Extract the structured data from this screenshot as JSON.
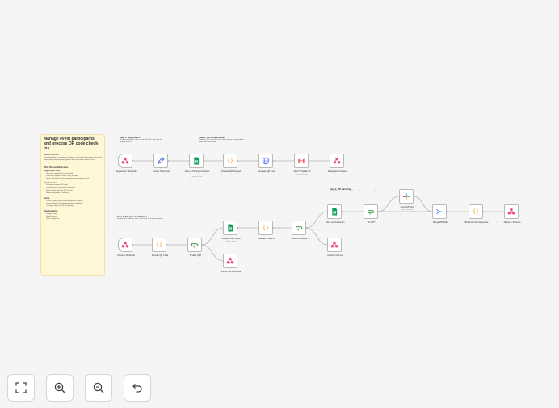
{
  "sticky": {
    "title": "Manage event participants and process QR code check-ins",
    "who_heading": "Who is this for?",
    "who_text": "Event organizers, conference managers, and community teams who need automated participant management with registration and check-in tracking.",
    "what_heading": "What this workflow does",
    "registration_heading": "Registration Flow",
    "registration_items": [
      "Receives registration via webhook",
      "Generates unique ticket ID and QR code",
      "Stores to Google Sheets and sends confirmation email"
    ],
    "checkin_heading": "Check-in Flow",
    "checkin_items": [
      "Decodes scanned QR code",
      "Validates ticket and blocks duplicates",
      "Sends Slack alerts for VIP arrivals",
      "Returns attendance statistics"
    ],
    "setup_heading": "Setup",
    "setup_items": [
      "Create Google Sheet with participants columns",
      "Connect Google Sheets and Gmail credentials",
      "Configure Slack for VIP notifications"
    ],
    "requirements_heading": "Requirements",
    "requirements_items": [
      "Google Sheets",
      "Gmail account",
      "Slack workspace"
    ]
  },
  "steps": {
    "registration": {
      "title": "Step 1: Registration",
      "desc": "Receive participant data, create ticket ID, and save to Google Sheets"
    },
    "qr_email": {
      "title": "Step 2: QR Code & Email",
      "desc": "Generate QR code with ticket data and send confirmation email with attachment"
    },
    "checkin": {
      "title": "Step 3: Check-in & Validation",
      "desc": "Decode QR, validate ticket, and check for duplicate entries"
    },
    "vip": {
      "title": "Step 4: VIP Handling",
      "desc": "Detect VIP tickets and send Slack notification to event staff"
    }
  },
  "nodes": {
    "registration_webhook": {
      "label": "Registration Webhook"
    },
    "create_ticket_data": {
      "label": "Create Ticket Data"
    },
    "save_to_sheet": {
      "label": "Save to Participants Sheet",
      "sub": "append: sheet"
    },
    "prepare_qr_payload": {
      "label": "Prepare QR Payload"
    },
    "generate_qr_code": {
      "label": "Generate QR Code"
    },
    "send_ticket_email": {
      "label": "Send Ticket Email",
      "sub": "send: message"
    },
    "registration_success": {
      "label": "Registration Success"
    },
    "checkin_webhook": {
      "label": "Check-in Webhook"
    },
    "decode_qr_code": {
      "label": "Decode QR Code"
    },
    "is_valid_qr": {
      "label": "Is Valid QR?"
    },
    "lookup_ticket": {
      "label": "Lookup Ticket in DB",
      "sub": "lookup: sheet"
    },
    "invalid_qr_response": {
      "label": "Invalid QR Response"
    },
    "validate_checkin": {
      "label": "Validate Check-in"
    },
    "checkin_allowed": {
      "label": "Check-in Allowed?"
    },
    "mark_checked_in": {
      "label": "Mark as Checked In",
      "sub": "update: sheet"
    },
    "checkin_denied": {
      "label": "Check-in Denied"
    },
    "is_vip": {
      "label": "Is VIP?"
    },
    "send_vip_alert": {
      "label": "Send VIP Alert",
      "sub": "post: message"
    },
    "merge_vip_path": {
      "label": "Merge VIP Path",
      "sub": "combine"
    },
    "build_success_response": {
      "label": "Build Success Response"
    },
    "checkin_success": {
      "label": "Check-in Success"
    }
  },
  "controls": {
    "fit": "fit-view-icon",
    "zoom_in": "zoom-in-icon",
    "zoom_out": "zoom-out-icon",
    "reset": "undo-icon"
  },
  "colors": {
    "canvas": "#f5f5f5",
    "sticky": "#fff6d5",
    "webhook": "#ea4b71",
    "code": "#ff9922",
    "sheets": "#0f9d58",
    "if": "#2b8a3e",
    "http": "#4a6cf7",
    "gmail": "#ea4335",
    "merge": "#2f6cf7",
    "edit": "#3a64c8"
  }
}
